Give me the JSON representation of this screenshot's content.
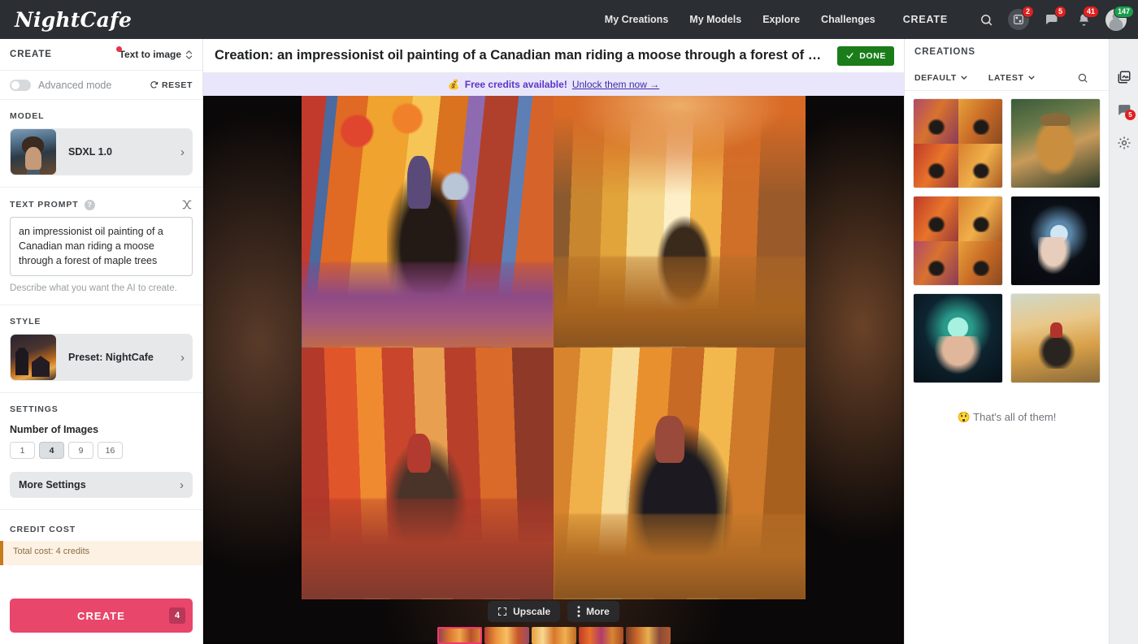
{
  "brand": {
    "name": "NightCafe"
  },
  "topnav": {
    "links": [
      {
        "label": "My Creations",
        "name": "nav-my-creations"
      },
      {
        "label": "My Models",
        "name": "nav-my-models"
      },
      {
        "label": "Explore",
        "name": "nav-explore"
      },
      {
        "label": "Challenges",
        "name": "nav-challenges"
      }
    ],
    "create_label": "CREATE",
    "icons": {
      "search": "search-icon",
      "dice": "dice-icon",
      "chat": "chat-icon",
      "bell": "bell-icon",
      "avatar": "avatar"
    },
    "badges": {
      "dice": "2",
      "chat": "5",
      "bell": "41",
      "credits": "147"
    }
  },
  "sidebar": {
    "header_label": "CREATE",
    "mode_label": "Text to image",
    "advanced_label": "Advanced mode",
    "advanced_on": false,
    "reset_label": "RESET",
    "model": {
      "section_label": "MODEL",
      "name": "SDXL 1.0"
    },
    "prompt": {
      "section_label": "TEXT PROMPT",
      "value": "an impressionist oil painting of a Canadian man riding a moose through a forest of maple trees",
      "helper": "Describe what you want the AI to create."
    },
    "style": {
      "section_label": "STYLE",
      "name": "Preset: NightCafe"
    },
    "settings": {
      "section_label": "SETTINGS",
      "number_of_images_label": "Number of Images",
      "number_options": [
        "1",
        "4",
        "9",
        "16"
      ],
      "number_selected": "4",
      "more_settings_label": "More Settings"
    },
    "credit_cost": {
      "section_label": "CREDIT COST",
      "note": "Total cost: 4 credits"
    },
    "create_button": {
      "label": "CREATE",
      "count": "4"
    }
  },
  "center": {
    "title": "Creation: an impressionist oil painting of a Canadian man riding a moose through a forest of m...",
    "done_label": "DONE",
    "promo": {
      "emoji": "💰",
      "text": "Free credits available!",
      "link": "Unlock them now →"
    },
    "toolbar": {
      "upscale_label": "Upscale",
      "more_label": "More"
    },
    "tiles": [
      {
        "name": "result-tile-1"
      },
      {
        "name": "result-tile-2"
      },
      {
        "name": "result-tile-3"
      },
      {
        "name": "result-tile-4"
      }
    ],
    "filmstrip": [
      {
        "name": "filmstrip-item-1",
        "selected": true
      },
      {
        "name": "filmstrip-item-2",
        "selected": false
      },
      {
        "name": "filmstrip-item-3",
        "selected": false
      },
      {
        "name": "filmstrip-item-4",
        "selected": false
      },
      {
        "name": "filmstrip-item-5",
        "selected": false
      }
    ]
  },
  "right": {
    "title": "CREATIONS",
    "filter_label": "DEFAULT",
    "sort_label": "LATEST",
    "end_message": "😲 That's all of them!",
    "items": [
      {
        "name": "creation-moose-grid-1",
        "kind": "quad"
      },
      {
        "name": "creation-dog-hat",
        "kind": "dog"
      },
      {
        "name": "creation-moose-grid-2",
        "kind": "quad"
      },
      {
        "name": "creation-moon-hand",
        "kind": "moon"
      },
      {
        "name": "creation-orb-hands",
        "kind": "orb"
      },
      {
        "name": "creation-moose-rider",
        "kind": "ride"
      }
    ],
    "rail": {
      "gallery": "gallery-icon",
      "chat_badge": "5",
      "settings": "gear-icon"
    }
  },
  "colors": {
    "accent": "#e8466b",
    "done": "#1a7d1a",
    "promo_bg": "#e9e6fb",
    "nav_bg": "#2b2f33"
  }
}
